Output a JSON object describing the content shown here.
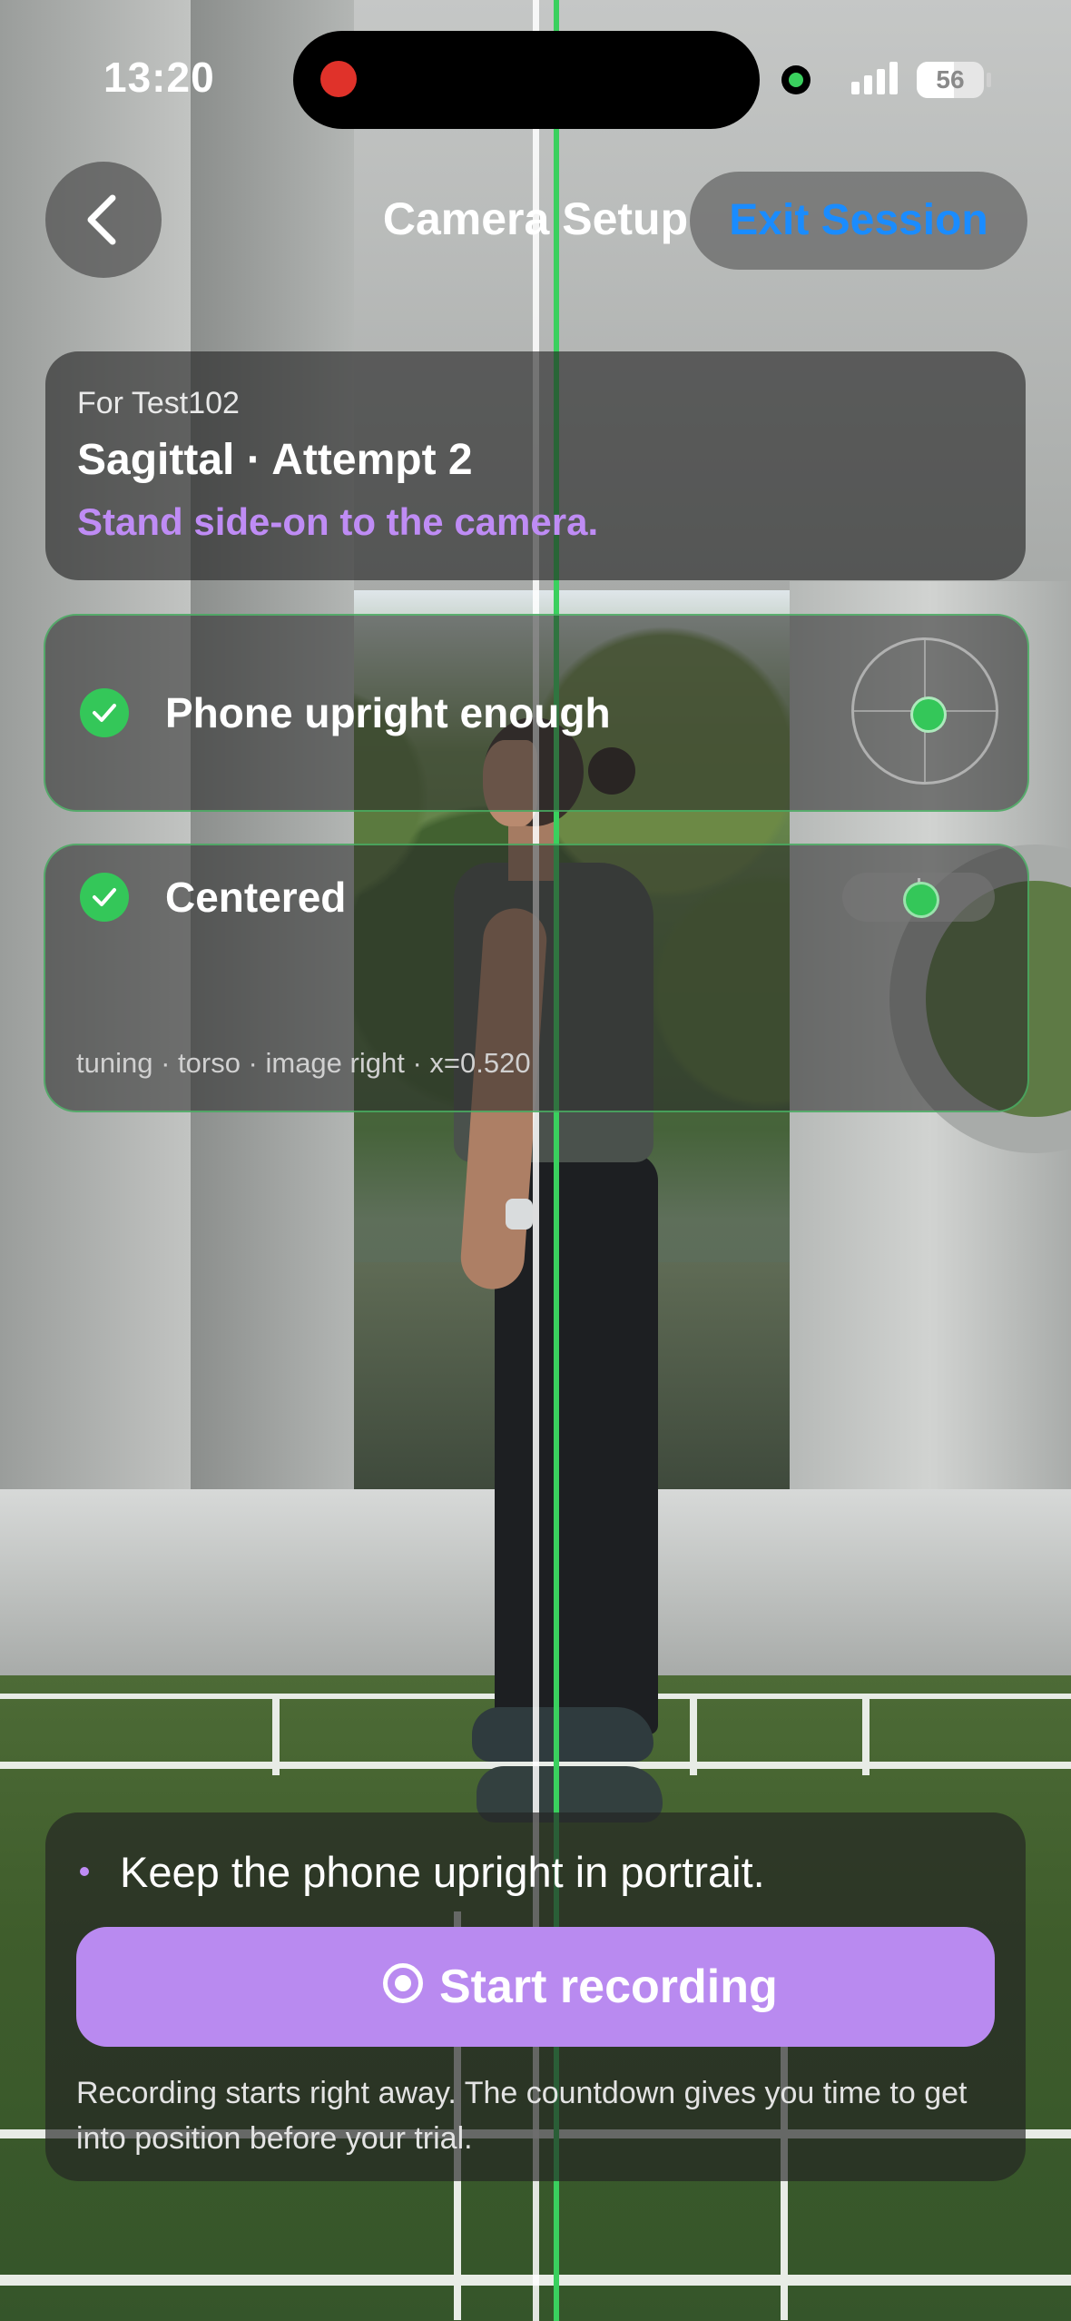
{
  "status_bar": {
    "time": "13:20",
    "battery": "56",
    "battery_level": 0.56,
    "recording_indicator_color": "#e0322a",
    "camera_indicator_color": "#3ad05e"
  },
  "nav": {
    "back_icon": "chevron-left-icon",
    "title": "Camera Setup",
    "exit_label": "Exit Session"
  },
  "session": {
    "subject": "For Test102",
    "trial": "Sagittal · Attempt 2",
    "instruction": "Stand side-on to the camera."
  },
  "checks": [
    {
      "label": "Phone upright enough",
      "status": "ok",
      "indicator": "level-icon"
    },
    {
      "label": "Centered",
      "status": "ok",
      "indicator": "center-slider-icon"
    }
  ],
  "tuning": "tuning · torso · image right · x=0.520",
  "bottom": {
    "tip": "Keep the phone upright in portrait.",
    "start_label": "Start recording",
    "note": "Recording starts right away. The countdown gives you time to get into position before your trial."
  },
  "colors": {
    "accent": "#b98af0",
    "instruction": "#bf8cf5",
    "ok": "#34c759",
    "link": "#1a8cff",
    "guide": "#3ad05e"
  }
}
